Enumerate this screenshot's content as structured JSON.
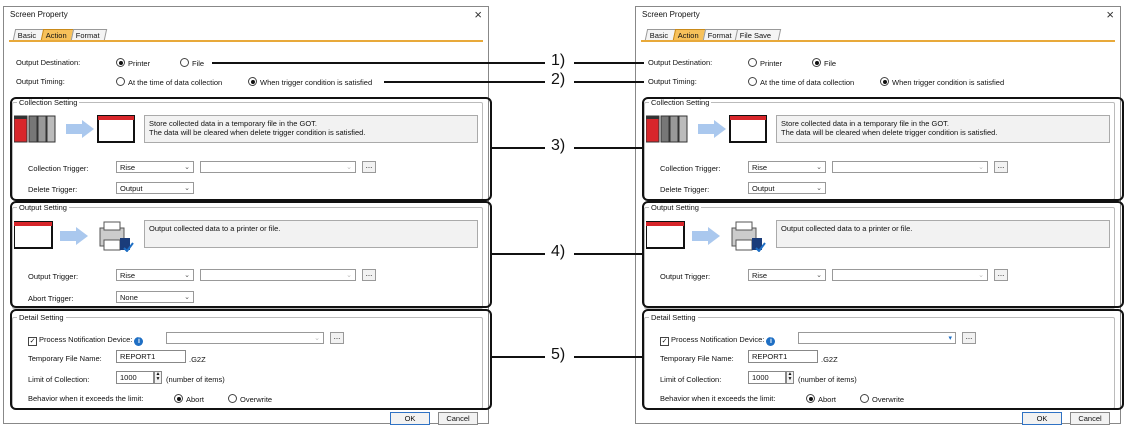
{
  "dialogs": [
    {
      "title": "Screen Property",
      "close_glyph": "×",
      "tabs": [
        "Basic",
        "Action",
        "Format"
      ],
      "active_tab": "Action",
      "output_destination": {
        "label": "Output Destination:",
        "options": [
          "Printer",
          "File"
        ],
        "selected": "Printer"
      },
      "output_timing": {
        "label": "Output Timing:",
        "options": [
          "At the time of data collection",
          "When trigger condition is satisfied"
        ],
        "selected": "When trigger condition is satisfied"
      },
      "collection_setting": {
        "title": "Collection Setting",
        "description": [
          "Store collected data in a temporary file in the GOT.",
          "The data will be cleared when delete trigger condition is satisfied."
        ],
        "collection_trigger": {
          "label": "Collection Trigger:",
          "value": "Rise",
          "device": ""
        },
        "delete_trigger": {
          "label": "Delete Trigger:",
          "value": "Output"
        }
      },
      "output_setting": {
        "title": "Output Setting",
        "description": "Output collected data to a printer or file.",
        "output_trigger": {
          "label": "Output Trigger:",
          "value": "Rise",
          "device": ""
        },
        "abort_trigger": {
          "label": "Abort Trigger:",
          "value": "None"
        }
      },
      "detail_setting": {
        "title": "Detail Setting",
        "process_notification": {
          "label": "Process Notification Device:",
          "checked": true,
          "device": ""
        },
        "temp_file": {
          "label": "Temporary File Name:",
          "value": "REPORT1",
          "ext": ".G2Z"
        },
        "limit": {
          "label": "Limit of Collection:",
          "value": "1000",
          "unit": "(number of items)"
        },
        "behavior": {
          "label": "Behavior when it exceeds the limit:",
          "options": [
            "Abort",
            "Overwrite"
          ],
          "selected": "Abort"
        }
      },
      "buttons": {
        "ok": "OK",
        "cancel": "Cancel"
      },
      "browse_label": "..."
    },
    {
      "title": "Screen Property",
      "close_glyph": "×",
      "tabs": [
        "Basic",
        "Action",
        "Format",
        "File Save"
      ],
      "active_tab": "Action",
      "output_destination": {
        "label": "Output Destination:",
        "options": [
          "Printer",
          "File"
        ],
        "selected": "File"
      },
      "output_timing": {
        "label": "Output Timing:",
        "options": [
          "At the time of data collection",
          "When trigger condition is satisfied"
        ],
        "selected": "When trigger condition is satisfied"
      },
      "collection_setting": {
        "title": "Collection Setting",
        "description": [
          "Store collected data in a temporary file in the GOT.",
          "The data will be cleared when delete trigger condition is satisfied."
        ],
        "collection_trigger": {
          "label": "Collection Trigger:",
          "value": "Rise",
          "device": ""
        },
        "delete_trigger": {
          "label": "Delete Trigger:",
          "value": "Output"
        }
      },
      "output_setting": {
        "title": "Output Setting",
        "description": "Output collected data to a printer or file.",
        "output_trigger": {
          "label": "Output Trigger:",
          "value": "Rise",
          "device": ""
        }
      },
      "detail_setting": {
        "title": "Detail Setting",
        "process_notification": {
          "label": "Process Notification Device:",
          "checked": true,
          "device": ""
        },
        "temp_file": {
          "label": "Temporary File Name:",
          "value": "REPORT1",
          "ext": ".G2Z"
        },
        "limit": {
          "label": "Limit of Collection:",
          "value": "1000",
          "unit": "(number of items)"
        },
        "behavior": {
          "label": "Behavior when it exceeds the limit:",
          "options": [
            "Abort",
            "Overwrite"
          ],
          "selected": "Abort"
        }
      },
      "buttons": {
        "ok": "OK",
        "cancel": "Cancel"
      },
      "browse_label": "..."
    }
  ],
  "callouts": [
    "1)",
    "2)",
    "3)",
    "4)",
    "5)"
  ],
  "colors": {
    "active_tab": "#f7c15a",
    "tab_underline": "#e8a93a",
    "info_icon": "#1f6fc4",
    "screen_red": "#d8262b"
  }
}
